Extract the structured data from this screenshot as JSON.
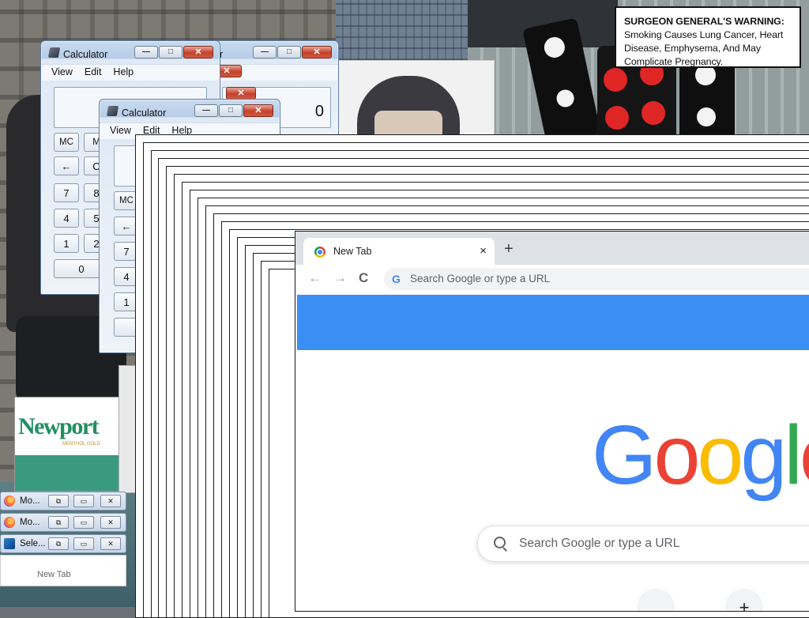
{
  "warning": {
    "heading": "SURGEON GENERAL'S WARNING:",
    "text": "Smoking Causes Lung Cancer, Heart Disease, Emphysema, And May Complicate Pregnancy."
  },
  "cigarette": {
    "brand": "Newport",
    "sub": "MENTHOL GOLD"
  },
  "calculators": [
    {
      "title": "Calculator",
      "menu": [
        "View",
        "Edit",
        "Help"
      ],
      "display": "0",
      "keys": [
        "MC",
        "M",
        "←",
        "C",
        "7",
        "8",
        "4",
        "5",
        "1",
        "2",
        "0"
      ]
    },
    {
      "title": "Calculator",
      "menu": [
        "View",
        "Edit",
        "Help"
      ],
      "display": "",
      "keys": [
        "MC",
        "←",
        "7",
        "4",
        "1"
      ]
    }
  ],
  "calc_partial": {
    "title_fragment": "or",
    "menu_fragment": "lp"
  },
  "window_controls": {
    "minimize": "—",
    "maximize": "□",
    "close": "✕"
  },
  "chrome": {
    "tab_title": "New Tab",
    "tab_close": "×",
    "new_tab": "+",
    "omnibox_placeholder": "Search Google or type a URL",
    "omnibox_icon": "G",
    "back": "←",
    "forward": "→",
    "reload": "C",
    "logo": [
      "G",
      "o",
      "o",
      "g",
      "l",
      "e"
    ],
    "logo_colors": [
      "#4285f4",
      "#ea4335",
      "#fbbc05",
      "#4285f4",
      "#34a853",
      "#ea4335"
    ],
    "search_placeholder": "Search Google or type a URL",
    "shortcut_add": "+"
  },
  "minimized": [
    {
      "label": "Mo...",
      "icon": "firefox-icon"
    },
    {
      "label": "Mo...",
      "icon": "firefox-icon"
    },
    {
      "label": "Sele...",
      "icon": "selenium-icon"
    }
  ],
  "mini_tab_label": "New Tab"
}
